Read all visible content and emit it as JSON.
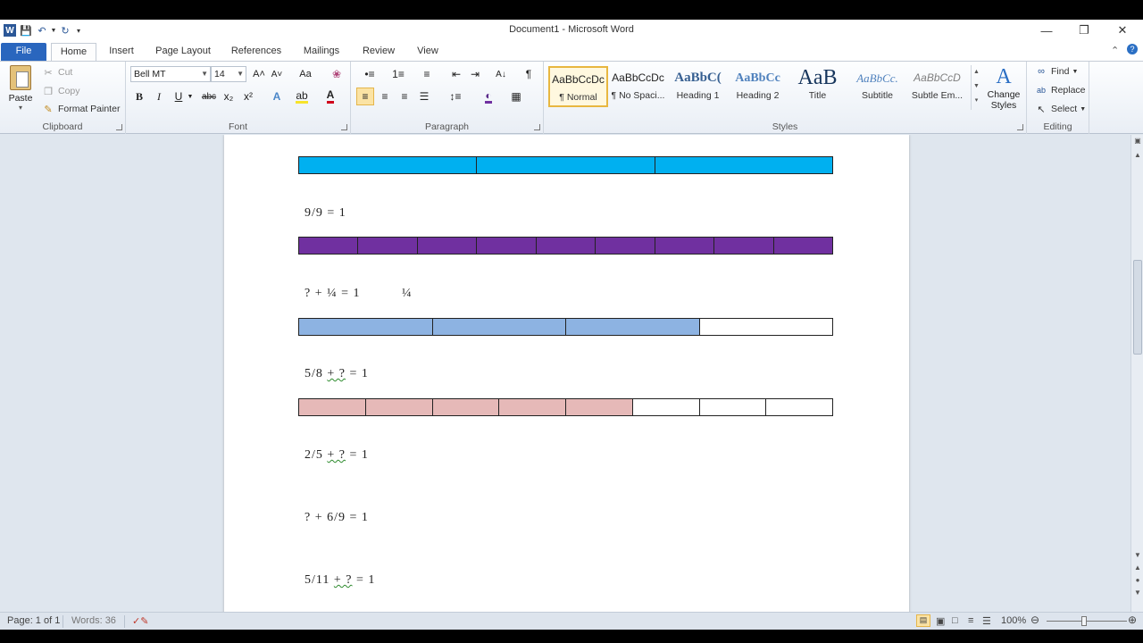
{
  "window": {
    "title": "Document1  -  Microsoft Word"
  },
  "tabs": [
    "File",
    "Home",
    "Insert",
    "Page Layout",
    "References",
    "Mailings",
    "Review",
    "View"
  ],
  "clipboard": {
    "paste": "Paste",
    "cut": "Cut",
    "copy": "Copy",
    "format_painter": "Format Painter",
    "group": "Clipboard"
  },
  "font": {
    "name": "Bell MT",
    "size": "14",
    "group": "Font",
    "bold": "B",
    "italic": "I",
    "underline": "U",
    "strike": "abc",
    "subscript": "x₂",
    "superscript": "x²",
    "grow": "A˄",
    "shrink": "A˅",
    "change_case": "Aa",
    "font_color": "A",
    "font_color_hex": "#d0021b",
    "highlight_hex": "#f7e32b"
  },
  "paragraph": {
    "group": "Paragraph"
  },
  "styles": {
    "group": "Styles",
    "items": [
      {
        "sample": "AaBbCcDc",
        "name": "¶ Normal"
      },
      {
        "sample": "AaBbCcDc",
        "name": "¶ No Spaci..."
      },
      {
        "sample": "AaBbC(",
        "name": "Heading 1"
      },
      {
        "sample": "AaBbCc",
        "name": "Heading 2"
      },
      {
        "sample": "AaB",
        "name": "Title"
      },
      {
        "sample": "AaBbCc.",
        "name": "Subtitle"
      },
      {
        "sample": "AaBbCcD",
        "name": "Subtle Em..."
      }
    ],
    "change_styles": "Change Styles"
  },
  "editing": {
    "group": "Editing",
    "find": "Find",
    "replace": "Replace",
    "select": "Select"
  },
  "document": {
    "bars": [
      {
        "color": "#00b0f0",
        "segments": 3,
        "filled": 3
      },
      {
        "color": "#7030a0",
        "segments": 9,
        "filled": 9
      },
      {
        "color": "#8db3e2",
        "segments": 4,
        "filled": 3
      },
      {
        "color": "#e6b9b8",
        "segments": 8,
        "filled": 5
      }
    ],
    "equations": [
      {
        "before": "9/9 = 1",
        "squiggle": "",
        "after": ""
      },
      {
        "before": "? + ¼ = 1",
        "squiggle": "",
        "after": ""
      },
      {
        "before": "5/8 ",
        "squiggle": "+ ?",
        "after": " = 1"
      },
      {
        "before": "2/5 ",
        "squiggle": "+ ?",
        "after": " = 1"
      },
      {
        "before": "? + 6/9 = 1",
        "squiggle": "",
        "after": ""
      },
      {
        "before": "5/11 ",
        "squiggle": "+ ?",
        "after": " = 1"
      }
    ],
    "aside": "¼"
  },
  "status": {
    "page": "Page: 1 of 1",
    "words": "Words: 36",
    "zoom": "100%"
  }
}
